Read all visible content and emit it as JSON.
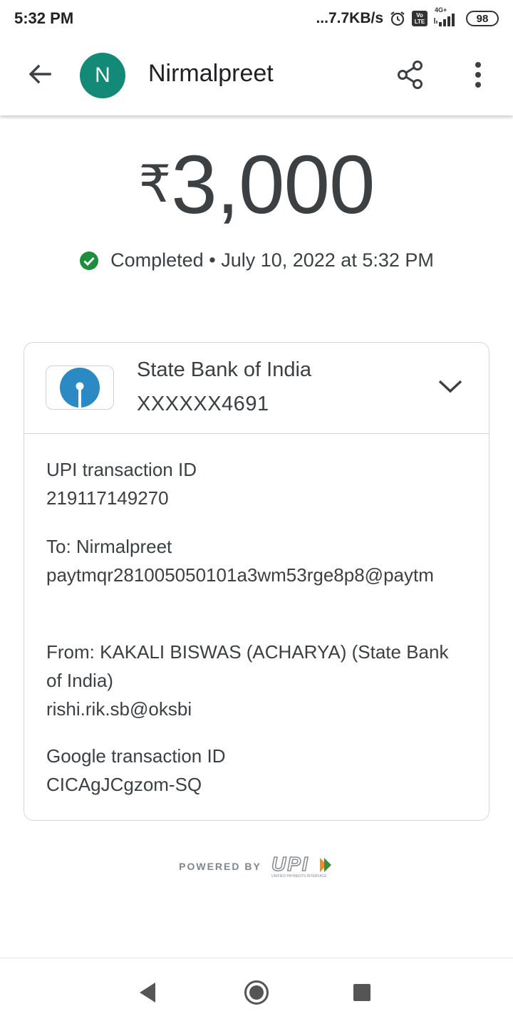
{
  "status_bar": {
    "time": "5:32 PM",
    "net_speed": "...7.7KB/s",
    "network_type": "4G+",
    "lte_label_top": "Vo",
    "lte_label_bottom": "LTE",
    "battery": "98",
    "icons": [
      "alarm-icon",
      "volte-icon",
      "signal-icon",
      "battery-icon"
    ]
  },
  "app_bar": {
    "avatar_letter": "N",
    "avatar_color": "#138a78",
    "title": "Nirmalpreet",
    "icons": [
      "back-arrow-icon",
      "share-icon",
      "more-vert-icon"
    ]
  },
  "payment": {
    "currency_symbol": "₹",
    "amount": "3,000",
    "status": "Completed",
    "separator": "•",
    "datetime": "July 10, 2022 at 5:32 PM",
    "status_color": "#1e8e3e"
  },
  "bank": {
    "name": "State Bank of India",
    "account": "XXXXXX4691",
    "logo_color": "#2b8ac4"
  },
  "details": [
    {
      "label": "UPI transaction ID",
      "value": "219117149270"
    },
    {
      "label": "To: Nirmalpreet",
      "value": "paytmqr281005050101a3wm53rge8p8@paytm"
    },
    {
      "label": "From: KAKALI  BISWAS (ACHARYA) (State Bank of India)",
      "value": "rishi.rik.sb@oksbi"
    },
    {
      "label": "Google transaction ID",
      "value": "CICAgJCgzom-SQ"
    }
  ],
  "footer": {
    "powered_by": "POWERED BY",
    "upi_logo_text": "UPI",
    "upi_sub": "UNIFIED PAYMENTS INTERFACE"
  },
  "nav_bar": {
    "icons": [
      "nav-back-icon",
      "nav-home-icon",
      "nav-recents-icon"
    ]
  }
}
